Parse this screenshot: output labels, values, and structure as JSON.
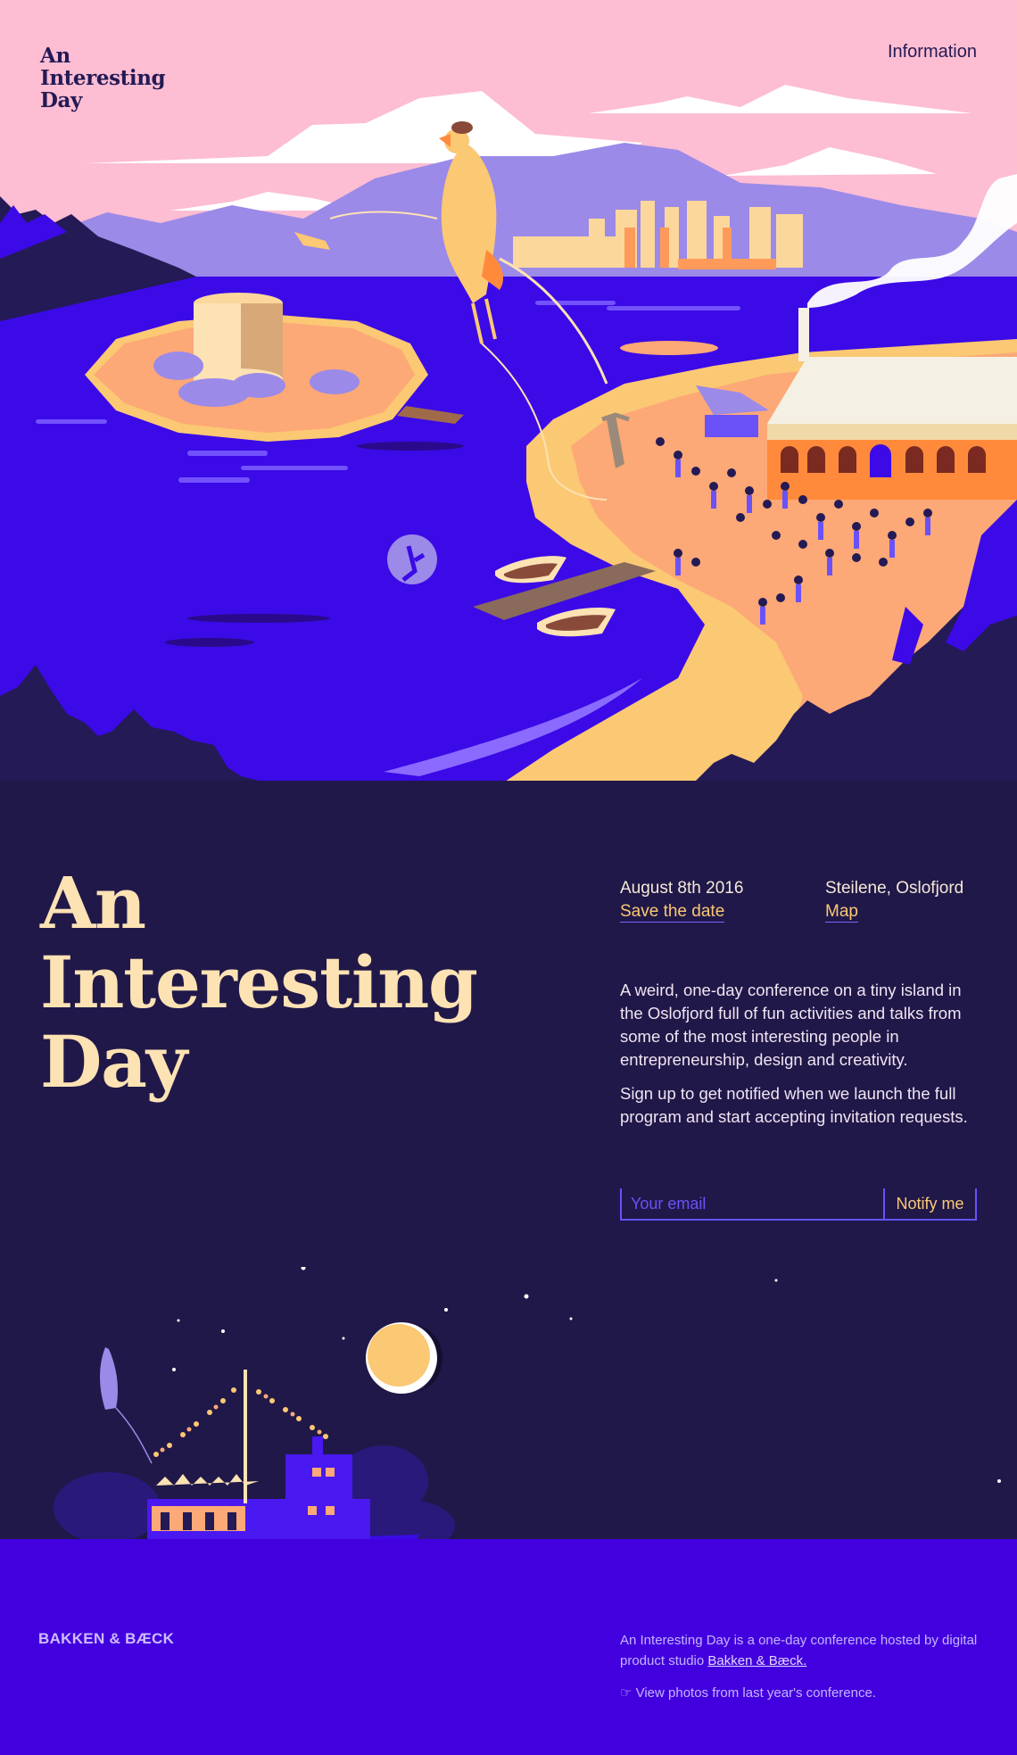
{
  "header": {
    "logo_line1": "An",
    "logo_line2": "Interesting",
    "logo_line3": "Day",
    "nav_information": "Information"
  },
  "hero_title": {
    "line1": "An",
    "line2": "Interesting",
    "line3": "Day"
  },
  "event": {
    "date": "August 8th 2016",
    "date_link": "Save the date",
    "location": "Steilene, Oslofjord",
    "location_link": "Map"
  },
  "description": {
    "paragraph1": "A weird, one-day conference on a tiny island in the Oslofjord full of fun activities and talks from some of the most interesting people in entrepreneurship, design and creativity.",
    "paragraph2": "Sign up to get notified when we launch the full program and start accepting invitation requests."
  },
  "signup": {
    "email_placeholder": "Your email",
    "email_value": "",
    "notify_label": "Notify me"
  },
  "footer": {
    "brand": "BAKKEN & BÆCK",
    "hosted_text": "An Interesting Day is a one-day conference hosted by digital product studio ",
    "hosted_link": "Bakken & Bæck.",
    "photos_link": "☞ View photos from last year's conference."
  },
  "colors": {
    "sky_pink": "#fdbdd3",
    "fjord_blue": "#3b0ae6",
    "night_navy": "#201848",
    "cream": "#fde2b4",
    "accent_orange": "#fbc874",
    "underline_violet": "#6552ff",
    "footer_blue": "#4300de"
  },
  "icons": {
    "pointing_hand": "pointing-hand-icon"
  }
}
